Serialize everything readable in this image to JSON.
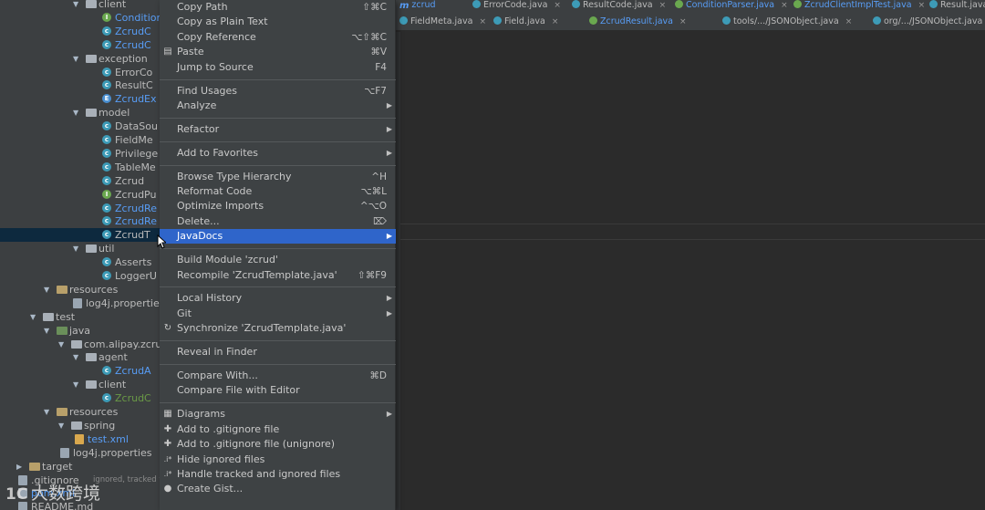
{
  "tree": [
    {
      "indent": 82,
      "arrow": "▼",
      "kind": "folder",
      "label": "client",
      "style": "normal"
    },
    {
      "indent": 112,
      "kind": "class",
      "icon": "I",
      "label": "Condition",
      "style": "blue"
    },
    {
      "indent": 112,
      "kind": "class",
      "label": "ZcrudC",
      "style": "blue"
    },
    {
      "indent": 112,
      "kind": "class",
      "label": "ZcrudC",
      "style": "blue"
    },
    {
      "indent": 82,
      "arrow": "▼",
      "kind": "folder",
      "label": "exception",
      "style": "normal"
    },
    {
      "indent": 112,
      "kind": "class",
      "label": "ErrorCo",
      "style": "normal"
    },
    {
      "indent": 112,
      "kind": "class",
      "label": "ResultC",
      "style": "normal"
    },
    {
      "indent": 112,
      "kind": "class",
      "icon": "E",
      "label": "ZcrudEx",
      "style": "blue"
    },
    {
      "indent": 82,
      "arrow": "▼",
      "kind": "folder",
      "label": "model",
      "style": "normal"
    },
    {
      "indent": 112,
      "kind": "class",
      "label": "DataSou",
      "style": "normal"
    },
    {
      "indent": 112,
      "kind": "class",
      "label": "FieldMe",
      "style": "normal"
    },
    {
      "indent": 112,
      "kind": "class",
      "label": "Privilege",
      "style": "normal"
    },
    {
      "indent": 112,
      "kind": "class",
      "label": "TableMe",
      "style": "normal"
    },
    {
      "indent": 112,
      "kind": "class",
      "label": "Zcrud",
      "style": "normal"
    },
    {
      "indent": 112,
      "kind": "class",
      "icon": "I",
      "label": "ZcrudPu",
      "style": "normal"
    },
    {
      "indent": 112,
      "kind": "class",
      "label": "ZcrudRe",
      "style": "blue"
    },
    {
      "indent": 112,
      "kind": "class",
      "label": "ZcrudRe",
      "style": "blue"
    },
    {
      "indent": 112,
      "kind": "class",
      "label": "ZcrudT",
      "style": "normal",
      "selected": true
    },
    {
      "indent": 82,
      "arrow": "▼",
      "kind": "folder",
      "label": "util",
      "style": "normal"
    },
    {
      "indent": 112,
      "kind": "class",
      "label": "Asserts",
      "style": "normal"
    },
    {
      "indent": 112,
      "kind": "class",
      "label": "LoggerU",
      "style": "normal"
    },
    {
      "indent": 50,
      "arrow": "▼",
      "kind": "resfolder",
      "label": "resources",
      "style": "normal"
    },
    {
      "indent": 80,
      "kind": "props",
      "label": "log4j.properties",
      "style": "normal"
    },
    {
      "indent": 35,
      "arrow": "▼",
      "kind": "folder",
      "label": "test",
      "style": "normal"
    },
    {
      "indent": 50,
      "arrow": "▼",
      "kind": "javafolder",
      "label": "java",
      "style": "normal"
    },
    {
      "indent": 66,
      "arrow": "▼",
      "kind": "folder",
      "label": "com.alipay.zcrud",
      "style": "normal"
    },
    {
      "indent": 82,
      "arrow": "▼",
      "kind": "folder",
      "label": "agent",
      "style": "normal"
    },
    {
      "indent": 112,
      "kind": "class",
      "label": "ZcrudA",
      "style": "blue"
    },
    {
      "indent": 82,
      "arrow": "▼",
      "kind": "folder",
      "label": "client",
      "style": "normal"
    },
    {
      "indent": 112,
      "kind": "class",
      "label": "ZcrudC",
      "style": "green"
    },
    {
      "indent": 50,
      "arrow": "▼",
      "kind": "resfolder",
      "label": "resources",
      "style": "normal"
    },
    {
      "indent": 66,
      "arrow": "▼",
      "kind": "folder",
      "label": "spring",
      "style": "normal"
    },
    {
      "indent": 82,
      "kind": "xml",
      "label": "test.xml",
      "style": "blue"
    },
    {
      "indent": 66,
      "kind": "props",
      "label": "log4j.properties",
      "style": "normal"
    },
    {
      "indent": 20,
      "arrow": "▶",
      "kind": "resfolder",
      "label": "target",
      "style": "normal"
    },
    {
      "indent": 20,
      "kind": "file",
      "label": ".gitignore",
      "suffix": "ignored, tracked wi",
      "style": "normal"
    },
    {
      "indent": 20,
      "kind": "file",
      "label": "pom.xml",
      "style": "blue"
    },
    {
      "indent": 20,
      "kind": "file",
      "label": "README.md",
      "style": "normal"
    }
  ],
  "tabs_row1": [
    {
      "label": "zcrud",
      "icon": "m",
      "active": true
    },
    {
      "label": "ErrorCode.java",
      "icon": "c",
      "close": "×"
    },
    {
      "label": "ResultCode.java",
      "icon": "c",
      "close": "×"
    },
    {
      "label": "ConditionParser.java",
      "icon": "c",
      "close": "×",
      "active": true
    },
    {
      "label": "ZcrudClientImplTest.java",
      "icon": "c",
      "close": "×",
      "active": true
    },
    {
      "label": "Result.java",
      "icon": "c",
      "close": "×"
    }
  ],
  "tabs_row2": [
    {
      "label": "FieldMeta.java",
      "icon": "c",
      "close": "×"
    },
    {
      "label": "Field.java",
      "icon": "c",
      "close": "×"
    },
    {
      "label": "ZcrudResult.java",
      "icon": "c",
      "close": "×",
      "active": true
    },
    {
      "label": "tools/.../JSONObject.java",
      "icon": "c",
      "close": "×"
    },
    {
      "label": "org/.../JSONObject.java",
      "icon": "c",
      "close": "×"
    }
  ],
  "menu": [
    {
      "label": "Copy Path",
      "shortcut": "⇧⌘C"
    },
    {
      "label": "Copy as Plain Text"
    },
    {
      "label": "Copy Reference",
      "shortcut": "⌥⇧⌘C"
    },
    {
      "label": "Paste",
      "shortcut": "⌘V",
      "icon": "paste-icon",
      "glyph": "▤"
    },
    {
      "label": "Jump to Source",
      "shortcut": "F4"
    },
    {
      "sep": true
    },
    {
      "label": "Find Usages",
      "shortcut": "⌥F7"
    },
    {
      "label": "Analyze",
      "submenu": true
    },
    {
      "sep": true
    },
    {
      "label": "Refactor",
      "submenu": true
    },
    {
      "sep": true
    },
    {
      "label": "Add to Favorites",
      "submenu": true
    },
    {
      "sep": true
    },
    {
      "label": "Browse Type Hierarchy",
      "shortcut": "^H"
    },
    {
      "label": "Reformat Code",
      "shortcut": "⌥⌘L"
    },
    {
      "label": "Optimize Imports",
      "shortcut": "^⌥O"
    },
    {
      "label": "Delete...",
      "shortcut": "⌦"
    },
    {
      "label": "JavaDocs",
      "submenu": true,
      "highlight": true
    },
    {
      "sep": true
    },
    {
      "label": "Build Module 'zcrud'"
    },
    {
      "label": "Recompile 'ZcrudTemplate.java'",
      "shortcut": "⇧⌘F9"
    },
    {
      "sep": true
    },
    {
      "label": "Local History",
      "submenu": true
    },
    {
      "label": "Git",
      "submenu": true
    },
    {
      "label": "Synchronize 'ZcrudTemplate.java'",
      "icon": "sync-icon",
      "glyph": "↻"
    },
    {
      "sep": true
    },
    {
      "label": "Reveal in Finder"
    },
    {
      "sep": true
    },
    {
      "label": "Compare With...",
      "shortcut": "⌘D"
    },
    {
      "label": "Compare File with Editor"
    },
    {
      "sep": true
    },
    {
      "label": "Diagrams",
      "submenu": true,
      "icon": "diagram-icon",
      "glyph": "▦"
    },
    {
      "label": "Add to .gitignore file",
      "icon": "gitignore-icon",
      "glyph": "✚"
    },
    {
      "label": "Add to .gitignore file (unignore)",
      "icon": "gitignore-icon",
      "glyph": "✚"
    },
    {
      "label": "Hide ignored files",
      "icon": "ignore-icon",
      "glyph": ".i*"
    },
    {
      "label": "Handle tracked and ignored files",
      "icon": "ignore-icon",
      "glyph": ".i*"
    },
    {
      "label": "Create Gist...",
      "icon": "github-icon",
      "glyph": "●"
    }
  ],
  "watermark": {
    "logo": "1C",
    "text": "大数跨境"
  },
  "colors": {
    "menu_bg": "#3e4244",
    "highlight": "#2f65ca",
    "tree_bg": "#3c3f41",
    "editor_bg": "#2b2b2b"
  }
}
